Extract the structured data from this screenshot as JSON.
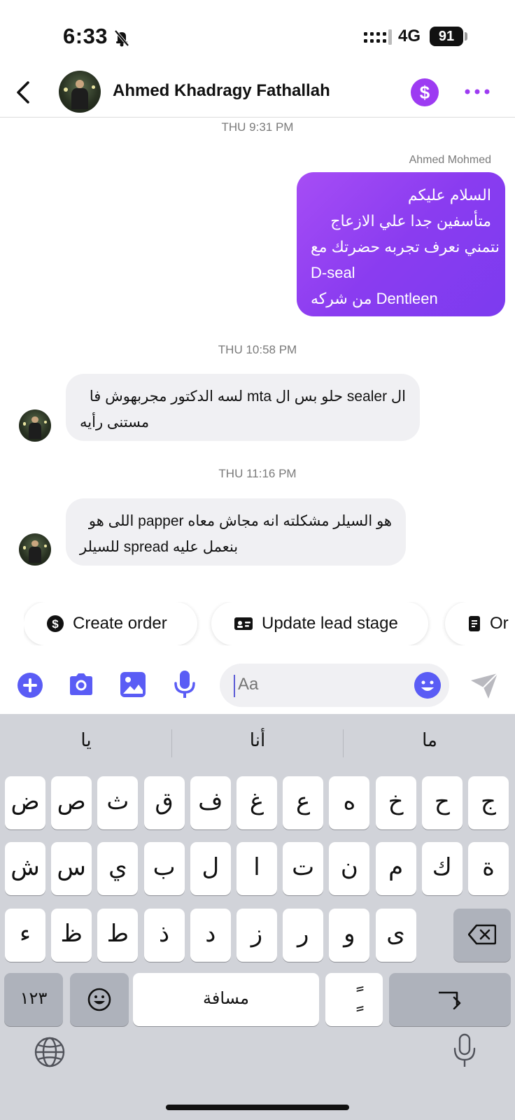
{
  "status_bar": {
    "time": "6:33",
    "network": "4G",
    "battery": "91"
  },
  "header": {
    "contact_name": "Ahmed Khadragy Fathallah",
    "dollar_symbol": "$"
  },
  "messages": [
    {
      "timestamp": "THU 9:31 PM",
      "sender": "Ahmed Mohmed",
      "direction": "outgoing",
      "lines": [
        "السلام عليكم",
        "متأسفين جدا علي الازعاج",
        "نتمني نعرف تجربه حضرتك مع",
        "D-seal",
        "Dentleen من شركه"
      ]
    },
    {
      "timestamp": "THU 10:58 PM",
      "direction": "incoming",
      "lines": [
        "ال sealer حلو بس ال mta لسه الدكتور مجربهوش فا",
        "مستنى رأيه"
      ]
    },
    {
      "timestamp": "THU 11:16 PM",
      "direction": "incoming",
      "lines": [
        "هو السيلر مشكلته انه مجاش معاه papper اللى هو",
        "بنعمل عليه spread للسيلر"
      ]
    }
  ],
  "quick_actions": [
    "Create order",
    "Update lead stage",
    "Or"
  ],
  "composer": {
    "placeholder": "Aa"
  },
  "keyboard": {
    "suggestions": [
      "يا",
      "أنا",
      "ما"
    ],
    "row1": [
      "ض",
      "ص",
      "ث",
      "ق",
      "ف",
      "غ",
      "ع",
      "ه",
      "خ",
      "ح",
      "ج"
    ],
    "row2": [
      "ش",
      "س",
      "ي",
      "ب",
      "ل",
      "ا",
      "ت",
      "ن",
      "م",
      "ك",
      "ة"
    ],
    "row3": [
      "ء",
      "ظ",
      "ط",
      "ذ",
      "د",
      "ز",
      "ر",
      "و",
      "ى"
    ],
    "numbers_key": "١٢٣",
    "space_label": "مسافة",
    "diacritic_key": "ًٍ"
  },
  "colors": {
    "accent": "#9d3bf2",
    "bubble_out_start": "#a64df5",
    "bubble_out_end": "#7c3bef",
    "icon_blue": "#5a5cf5",
    "bubble_in": "#f0f0f3"
  }
}
